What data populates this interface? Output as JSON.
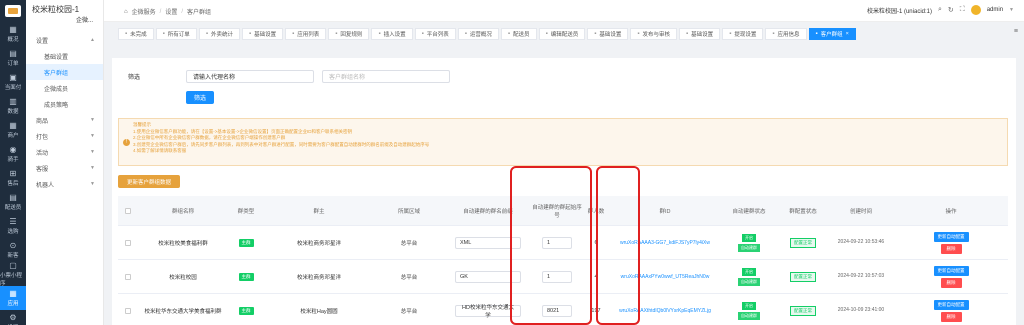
{
  "rail": {
    "items": [
      {
        "icon": "▦",
        "label": "概况"
      },
      {
        "icon": "▤",
        "label": "订单"
      },
      {
        "icon": "▣",
        "label": "当面付"
      },
      {
        "icon": "▥",
        "label": "数据"
      },
      {
        "icon": "▦",
        "label": "商户"
      },
      {
        "icon": "◉",
        "label": "骑手"
      },
      {
        "icon": "⊞",
        "label": "售后"
      },
      {
        "icon": "▤",
        "label": "配送员"
      },
      {
        "icon": "☰",
        "label": "选购"
      },
      {
        "icon": "⊙",
        "label": "新客"
      },
      {
        "icon": "▢",
        "label": "小票小程序"
      },
      {
        "icon": "▦",
        "label": "应用"
      },
      {
        "icon": "⚙",
        "label": "设置"
      }
    ],
    "active_index": 11
  },
  "sidebar": {
    "title": "校米粒校园-1",
    "subtitle": "企微...",
    "groups": [
      {
        "label": "设置",
        "expanded": true,
        "children": [
          "基础设置",
          "客户群组",
          "企微成员",
          "成员策略"
        ],
        "active_child": 1
      },
      {
        "label": "商品",
        "expanded": false
      },
      {
        "label": "打包",
        "expanded": false
      },
      {
        "label": "活动",
        "expanded": false
      },
      {
        "label": "客服",
        "expanded": false
      },
      {
        "label": "机器人",
        "expanded": false
      }
    ]
  },
  "topbar": {
    "breadcrumbs": [
      "企微服务",
      "设置",
      "客户群组"
    ],
    "store_name": "校米粒校园-1 (uniacid:1)",
    "user": "admin"
  },
  "tabs": [
    {
      "label": "未完成"
    },
    {
      "label": "所有订单"
    },
    {
      "label": "外卖统计"
    },
    {
      "label": "基础设置"
    },
    {
      "label": "应用列表"
    },
    {
      "label": "回复规则"
    },
    {
      "label": "插入设置"
    },
    {
      "label": "平台列表"
    },
    {
      "label": "运营概况"
    },
    {
      "label": "配送员"
    },
    {
      "label": "编辑配送员"
    },
    {
      "label": "基础设置"
    },
    {
      "label": "发布与审核"
    },
    {
      "label": "基础设置"
    },
    {
      "label": "提现设置"
    },
    {
      "label": "应用信息"
    },
    {
      "label": "客户群组",
      "active": true
    }
  ],
  "filter": {
    "label": "筛选",
    "name_placeholder": "请输入代理名称",
    "group_placeholder": "客户群组名称",
    "submit": "筛选"
  },
  "notice": {
    "title": "温馨提示",
    "lines": [
      "1.使用企业微信客户群功能，请在【设置->基本设置->企业微信设置】页面正确配置企业ID和客户联系相关密钥",
      "2.企业微信中所有企业微信客户群数据，请在企业微信客户端操作创建客户群",
      "3.创建完企业微信客户群后，请先同步客户群列表，再到列表中对客户群进行配置，同时需要为客户群配置自动建群时的群名前缀及自动建群起始序号",
      "4.如需了解详情请联系客服"
    ]
  },
  "sync_button": "更新客户群组数据",
  "table": {
    "headers": [
      "",
      "群组名称",
      "群类型",
      "群主",
      "所属区域",
      "自动建群的群名前缀",
      "自动建群的群起始序号",
      "群人数",
      "群ID",
      "自动建群状态",
      "群配置状态",
      "创建时间",
      "操作"
    ],
    "rows": [
      {
        "name": "校米粒校美食福利群",
        "type": "主群",
        "owner": "校米粒商务邓星洋",
        "region": "总平台",
        "prefix": "XML",
        "start": "1",
        "members": "6",
        "group_id": "wruXoRAAAA3-GG7_kdiFJS7yP7ly4iXw",
        "status_a": "开启",
        "status_b": "自动建群",
        "config": "配置正常",
        "created": "2024-09-22 10:53:46"
      },
      {
        "name": "校米粒校园",
        "type": "主群",
        "owner": "校米粒商务邓星洋",
        "region": "总平台",
        "prefix": "GK",
        "start": "1",
        "members": "4",
        "group_id": "wruXoRAAAxPYw0wwf_UT5ReaJhN0w",
        "status_a": "开启",
        "status_b": "自动建群",
        "config": "配置正常",
        "created": "2024-09-22 10:57:03"
      },
      {
        "name": "校米粒华东交通大学美食福利群",
        "type": "主群",
        "owner": "校米粒Hay圆圆",
        "region": "总平台",
        "prefix": "HD校米粒华东交通大学",
        "start": "8021",
        "members": "197",
        "group_id": "wruXoRAAXthtdIQb0lVYsrKpEqEMYZLjg",
        "status_a": "开启",
        "status_b": "自动建群",
        "config": "配置正常",
        "created": "2024-10-09 23:41:00"
      }
    ],
    "op_edit": "更新自动配置",
    "op_delete": "删除"
  }
}
